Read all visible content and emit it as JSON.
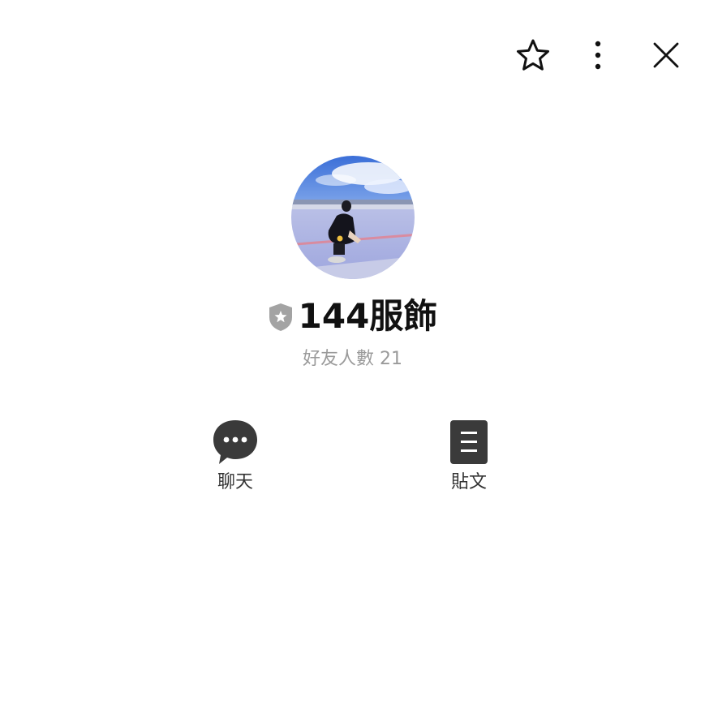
{
  "header": {
    "favorite_icon": "star-outline-icon",
    "more_icon": "vertical-dots-icon",
    "close_icon": "close-x-icon"
  },
  "profile": {
    "name": "144服飾",
    "badge_icon": "gray-shield-star-badge",
    "friends_text": "好友人數 21"
  },
  "actions": [
    {
      "label": "聊天",
      "icon": "chat-bubble-icon"
    },
    {
      "label": "貼文",
      "icon": "post-document-icon"
    }
  ],
  "colors": {
    "icon_dark": "#3a3a3a",
    "badge_gray": "#9e9e9e",
    "subtext_gray": "#9a9a9a"
  }
}
